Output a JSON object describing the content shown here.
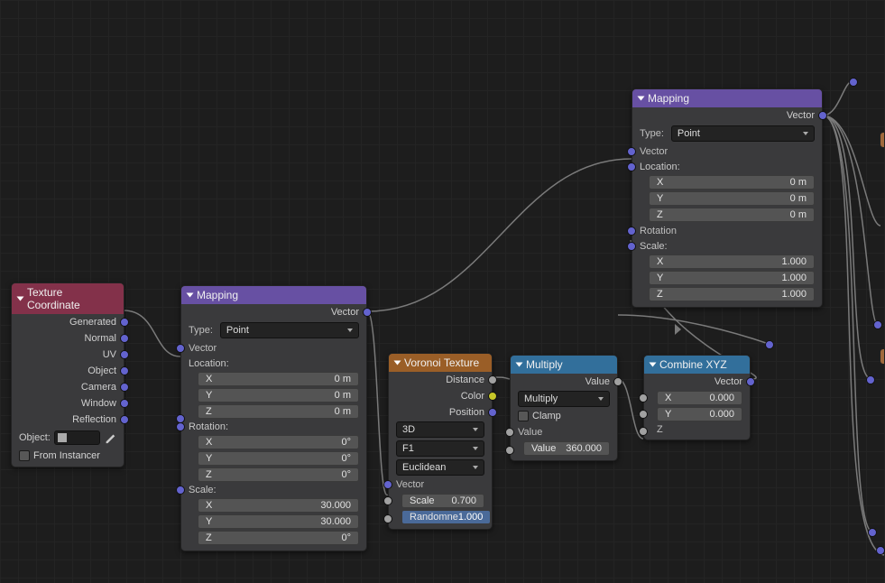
{
  "texcoord": {
    "title": "Texture Coordinate",
    "outputs": {
      "generated": "Generated",
      "normal": "Normal",
      "uv": "UV",
      "object": "Object",
      "camera": "Camera",
      "window": "Window",
      "reflection": "Reflection"
    },
    "object_label": "Object:",
    "from_instancer": "From Instancer"
  },
  "mapping1": {
    "title": "Mapping",
    "out_vector": "Vector",
    "type_label": "Type:",
    "type_value": "Point",
    "in_vector": "Vector",
    "location_label": "Location:",
    "location": {
      "x_label": "X",
      "x_val": "0 m",
      "y_label": "Y",
      "y_val": "0 m",
      "z_label": "Z",
      "z_val": "0 m"
    },
    "rotation_label": "Rotation:",
    "rotation": {
      "x_label": "X",
      "x_val": "0°",
      "y_label": "Y",
      "y_val": "0°",
      "z_label": "Z",
      "z_val": "0°"
    },
    "scale_label": "Scale:",
    "scale": {
      "x_label": "X",
      "x_val": "30.000",
      "y_label": "Y",
      "y_val": "30.000",
      "z_label": "Z",
      "z_val": "0°"
    }
  },
  "mapping2": {
    "title": "Mapping",
    "out_vector": "Vector",
    "type_label": "Type:",
    "type_value": "Point",
    "in_vector": "Vector",
    "location_label": "Location:",
    "location": {
      "x_label": "X",
      "x_val": "0 m",
      "y_label": "Y",
      "y_val": "0 m",
      "z_label": "Z",
      "z_val": "0 m"
    },
    "rotation_label": "Rotation",
    "scale_label": "Scale:",
    "scale": {
      "x_label": "X",
      "x_val": "1.000",
      "y_label": "Y",
      "y_val": "1.000",
      "z_label": "Z",
      "z_val": "1.000"
    }
  },
  "voronoi": {
    "title": "Voronoi Texture",
    "out_distance": "Distance",
    "out_color": "Color",
    "out_position": "Position",
    "dim": "3D",
    "feature": "F1",
    "metric": "Euclidean",
    "in_vector": "Vector",
    "scale_label": "Scale",
    "scale_val": "0.700",
    "rand_label": "Randomne",
    "rand_val": "1.000"
  },
  "multiply": {
    "title": "Multiply",
    "out_value": "Value",
    "op": "Multiply",
    "clamp": "Clamp",
    "in_value": "Value",
    "const_label": "Value",
    "const_val": "360.000"
  },
  "combine": {
    "title": "Combine XYZ",
    "out_vector": "Vector",
    "x_label": "X",
    "x_val": "0.000",
    "y_label": "Y",
    "y_val": "0.000",
    "z_label": "Z"
  }
}
